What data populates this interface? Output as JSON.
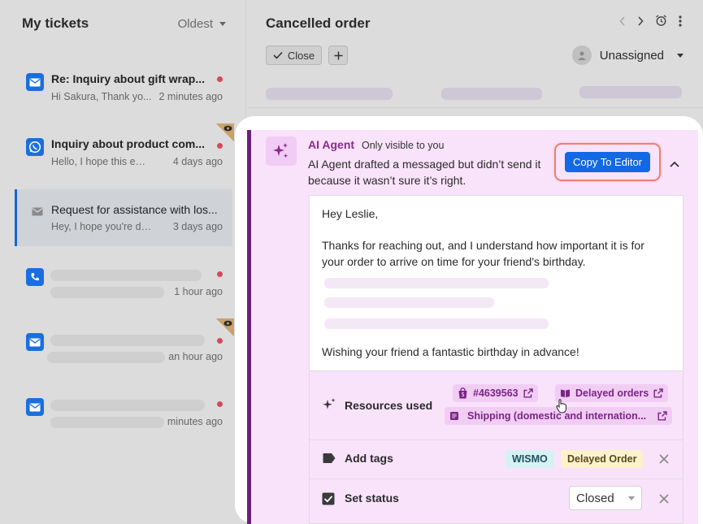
{
  "sidebar": {
    "title": "My tickets",
    "sort_label": "Oldest",
    "tickets": [
      {
        "subject": "Re: Inquiry about gift wrap...",
        "preview": "Hi Sakura, Thank yo...",
        "time": "2 minutes ago",
        "channel": "email"
      },
      {
        "subject": "Inquiry about product com...",
        "preview": "Hello, I hope this email...",
        "time": "4 days ago",
        "channel": "whatsapp"
      },
      {
        "subject": "Request for assistance with los...",
        "preview": "Hey, I hope you're doin...",
        "time": "3 days ago",
        "channel": "email"
      },
      {
        "subject": "",
        "preview": "",
        "time": "1 hour ago",
        "channel": "phone"
      },
      {
        "subject": "",
        "preview": "",
        "time": "an hour ago",
        "channel": "email"
      },
      {
        "subject": "",
        "preview": "",
        "time": "minutes ago",
        "channel": "email"
      }
    ]
  },
  "main": {
    "title": "Cancelled order",
    "close_label": "Close",
    "assignee": "Unassigned"
  },
  "ai": {
    "name": "AI Agent",
    "visibility": "Only visible to you",
    "message": "AI Agent drafted a messaged but didn’t send it because it wasn’t sure it’s right.",
    "copy_label": "Copy To Editor",
    "draft": {
      "greeting": "Hey Leslie,",
      "body": "Thanks for reaching out, and I understand how important it is for your order to arrive on time for your friend's birthday.",
      "closing": "Wishing your friend a fantastic birthday in advance!"
    },
    "resources_label": "Resources used",
    "resources": [
      "#4639563",
      "Delayed orders",
      "Shipping (domestic and internation..."
    ],
    "tags_label": "Add tags",
    "tags": [
      "WISMO",
      "Delayed Order"
    ],
    "status_label": "Set status",
    "status_value": "Closed"
  },
  "colors": {
    "accent": "#1368e3",
    "ai_purple": "#8a2a8f",
    "highlight": "#e8826e"
  }
}
